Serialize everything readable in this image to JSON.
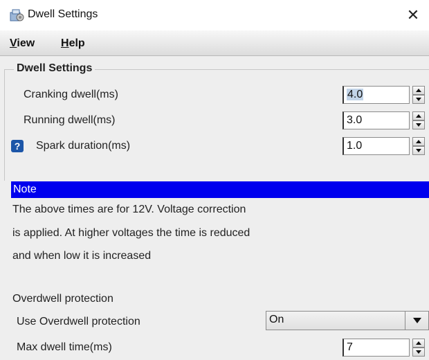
{
  "window": {
    "title": "Dwell Settings",
    "close_symbol": "✕",
    "icon": "app-settings-icon"
  },
  "menu": {
    "items": [
      {
        "label_mnemonic": "V",
        "label_rest": "iew"
      },
      {
        "label_mnemonic": "H",
        "label_rest": "elp"
      }
    ]
  },
  "group": {
    "title": "Dwell Settings",
    "rows": [
      {
        "label": "Cranking dwell(ms)",
        "value": "4.0"
      },
      {
        "label": "Running dwell(ms)",
        "value": "3.0"
      },
      {
        "label": "Spark duration(ms)",
        "value": "1.0",
        "help_icon": "?"
      }
    ]
  },
  "note": {
    "header": "Note",
    "lines": [
      "The above times are for 12V. Voltage correction",
      "is applied. At higher voltages the time is reduced",
      "and when low it is increased"
    ]
  },
  "overdwell": {
    "section_label": "Overdwell protection",
    "use_label": "Use Overdwell protection",
    "use_value": "On",
    "max_label": "Max dwell time(ms)",
    "max_value": "7"
  },
  "colors": {
    "note_header_bg": "#0000ee",
    "help_icon_bg": "#1c56a8",
    "selection_bg": "#c2d4e8"
  }
}
